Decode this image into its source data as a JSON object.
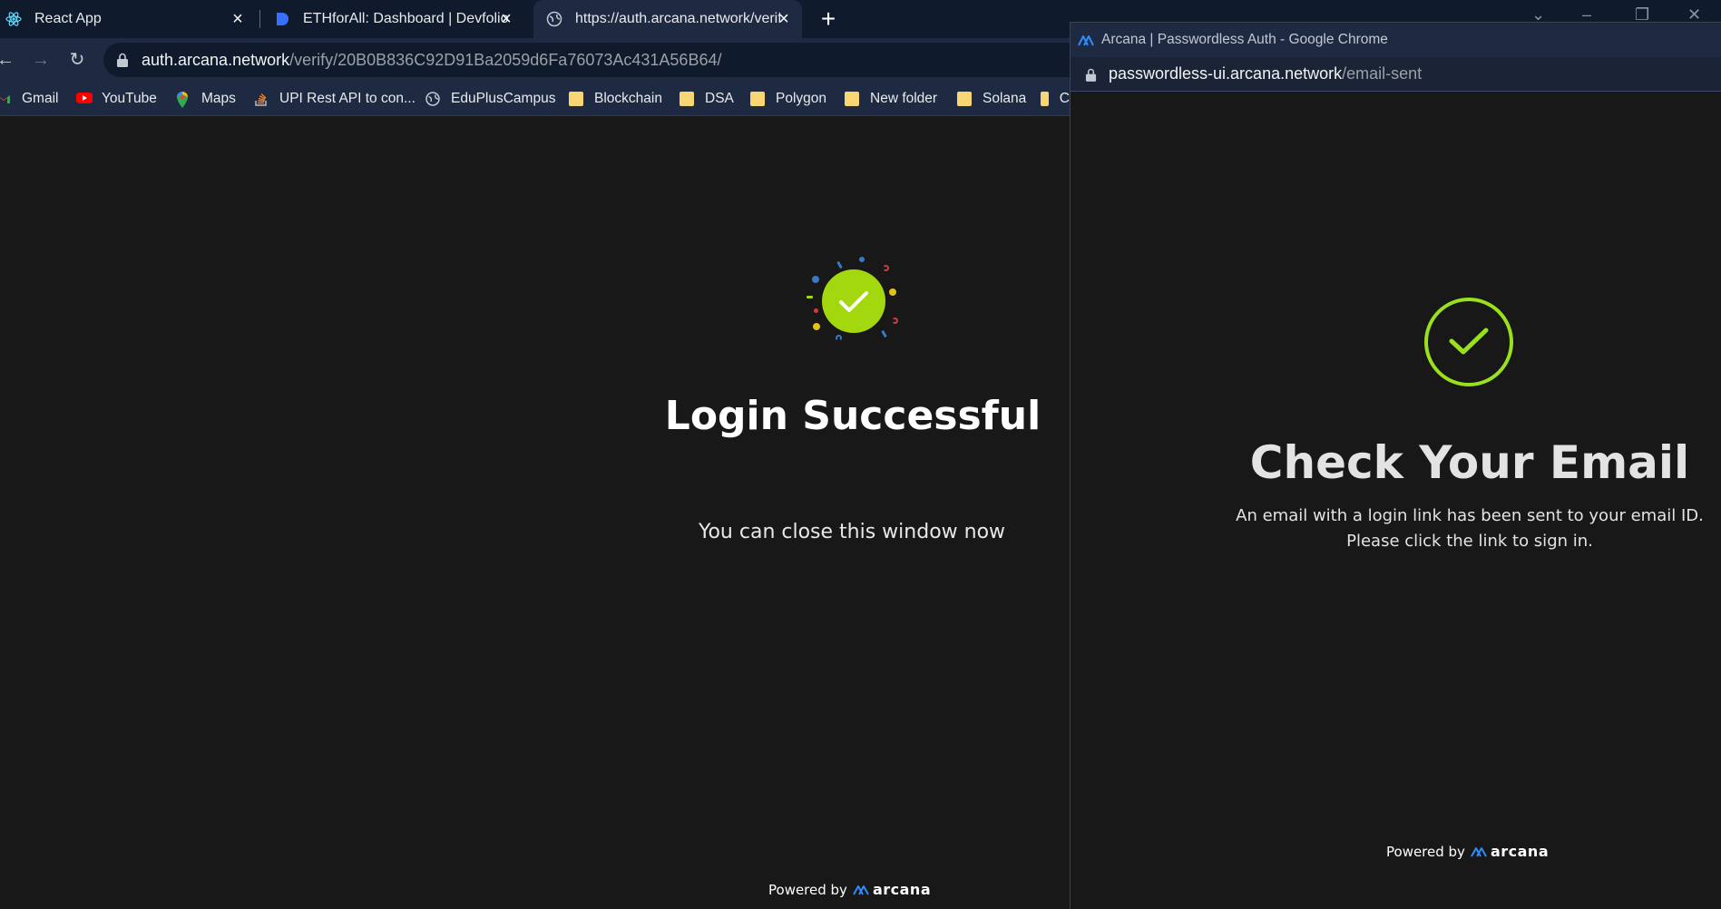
{
  "tabs": [
    {
      "title": "React App",
      "icon": "react-icon"
    },
    {
      "title": "ETHforAll: Dashboard | Devfolio",
      "icon": "devfolio-icon"
    },
    {
      "title": "https://auth.arcana.network/verify/",
      "icon": "globe-icon",
      "active": true
    }
  ],
  "address_bar": {
    "host": "auth.arcana.network",
    "path": "/verify/20B0B836C92D91Ba2059d6Fa76073Ac431A56B64/"
  },
  "bookmarks": [
    {
      "label": "Gmail",
      "icon": "gmail-icon"
    },
    {
      "label": "YouTube",
      "icon": "youtube-icon"
    },
    {
      "label": "Maps",
      "icon": "maps-icon"
    },
    {
      "label": "UPI Rest API to con...",
      "icon": "stackoverflow-icon"
    },
    {
      "label": "EduPlusCampus",
      "icon": "globe-icon"
    },
    {
      "label": "Blockchain",
      "icon": "folder-icon"
    },
    {
      "label": "DSA",
      "icon": "folder-icon"
    },
    {
      "label": "Polygon",
      "icon": "folder-icon"
    },
    {
      "label": "New folder",
      "icon": "folder-icon"
    },
    {
      "label": "Solana",
      "icon": "folder-icon"
    },
    {
      "label": "C",
      "icon": "folder-icon"
    }
  ],
  "main_page": {
    "title": "Login Successful",
    "subtitle": "You can close this window now",
    "powered_by": "Powered by",
    "brand": "arcana"
  },
  "popup": {
    "window_title": "Arcana | Passwordless Auth - Google Chrome",
    "url_host": "passwordless-ui.arcana.network",
    "url_path": "/email-sent",
    "title": "Check Your Email",
    "message": "An email with a login link has been sent to your email ID. Please click the link to sign in.",
    "powered_by": "Powered by",
    "brand": "arcana"
  },
  "colors": {
    "accent_green": "#a4d80e",
    "check_ring": "#9be01c",
    "chrome_dark": "#0f1a2c",
    "chrome_toolbar": "#1e2a41",
    "page_bg": "#181818",
    "arcana_blue": "#2f8cff"
  }
}
